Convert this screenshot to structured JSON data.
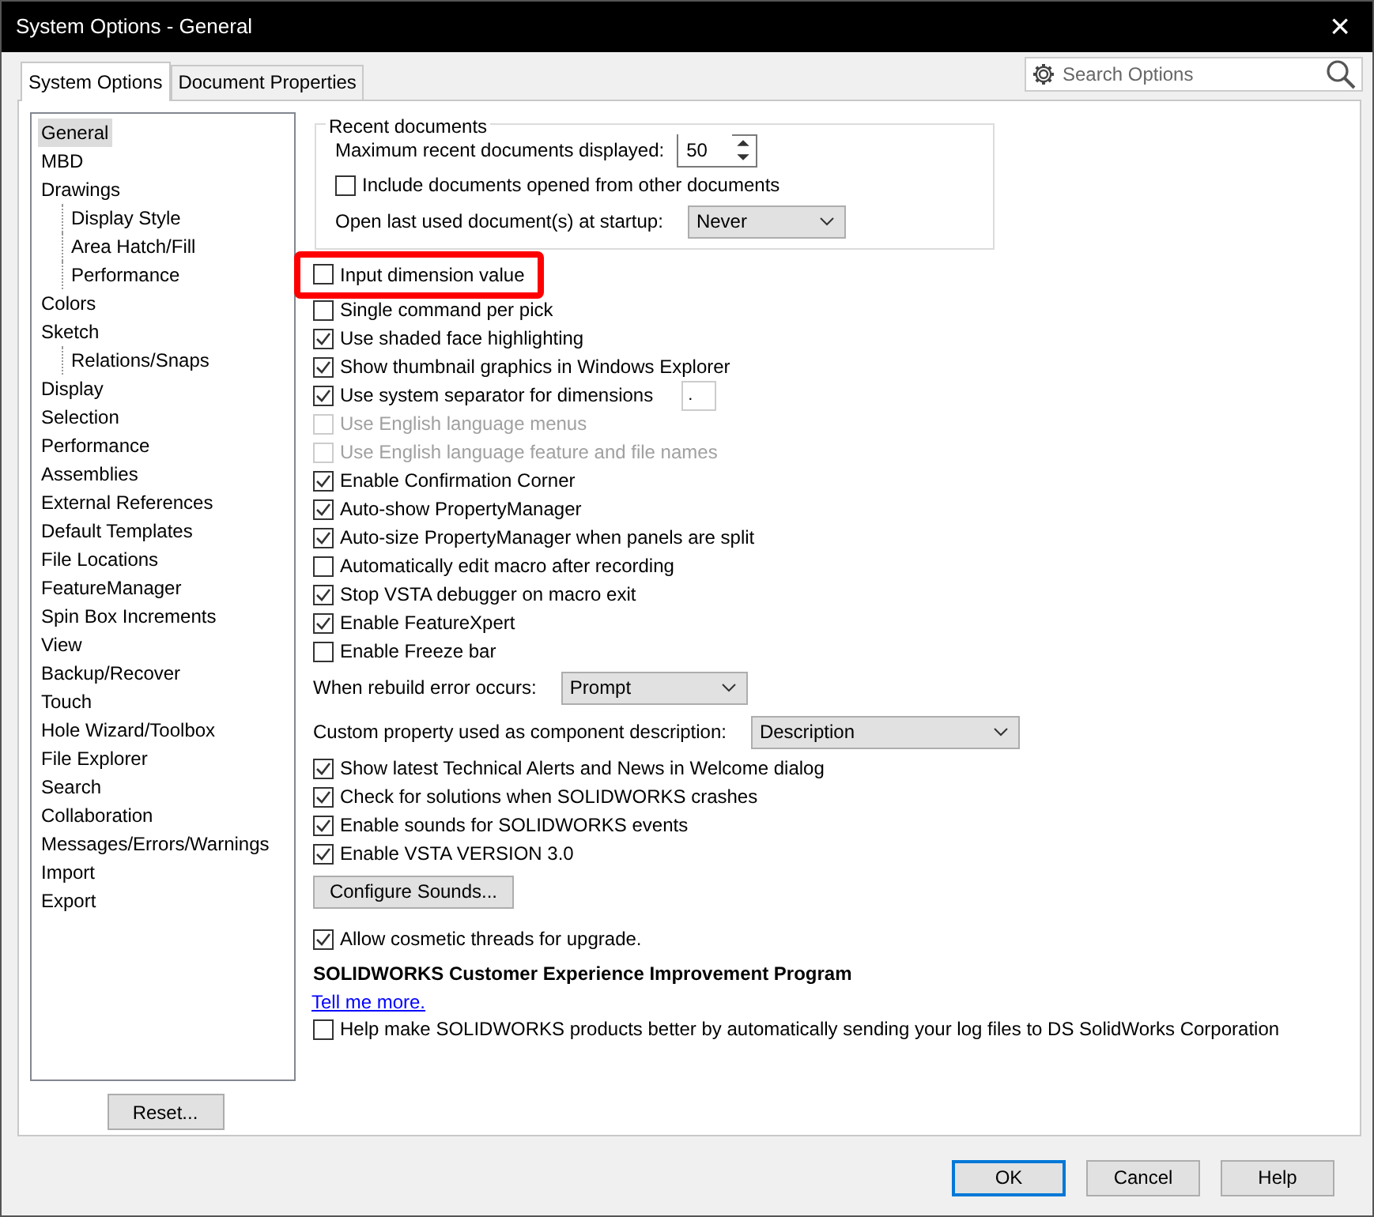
{
  "window": {
    "title": "System Options - General",
    "close": "×"
  },
  "tabs": [
    {
      "label": "System Options",
      "selected": true
    },
    {
      "label": "Document Properties",
      "selected": false
    }
  ],
  "search": {
    "placeholder": "Search Options"
  },
  "sidebar": {
    "items": [
      {
        "label": "General",
        "selected": true
      },
      {
        "label": "MBD",
        "selected": false
      },
      {
        "label": "Drawings",
        "selected": false,
        "children": [
          {
            "label": "Display Style",
            "selected": false
          },
          {
            "label": "Area Hatch/Fill",
            "selected": false
          },
          {
            "label": "Performance",
            "selected": false
          }
        ]
      },
      {
        "label": "Colors",
        "selected": false
      },
      {
        "label": "Sketch",
        "selected": false,
        "children": [
          {
            "label": "Relations/Snaps",
            "selected": false
          }
        ]
      },
      {
        "label": "Display",
        "selected": false
      },
      {
        "label": "Selection",
        "selected": false
      },
      {
        "label": "Performance",
        "selected": false
      },
      {
        "label": "Assemblies",
        "selected": false
      },
      {
        "label": "External References",
        "selected": false
      },
      {
        "label": "Default Templates",
        "selected": false
      },
      {
        "label": "File Locations",
        "selected": false
      },
      {
        "label": "FeatureManager",
        "selected": false
      },
      {
        "label": "Spin Box Increments",
        "selected": false
      },
      {
        "label": "View",
        "selected": false
      },
      {
        "label": "Backup/Recover",
        "selected": false
      },
      {
        "label": "Touch",
        "selected": false
      },
      {
        "label": "Hole Wizard/Toolbox",
        "selected": false
      },
      {
        "label": "File Explorer",
        "selected": false
      },
      {
        "label": "Search",
        "selected": false
      },
      {
        "label": "Collaboration",
        "selected": false
      },
      {
        "label": "Messages/Errors/Warnings",
        "selected": false
      },
      {
        "label": "Import",
        "selected": false
      },
      {
        "label": "Export",
        "selected": false
      }
    ],
    "reset_button": "Reset..."
  },
  "recent_documents": {
    "title": "Recent documents",
    "max_label": "Maximum recent documents displayed:",
    "max_value": "50",
    "include": {
      "label": "Include documents opened from other documents",
      "checked": false
    },
    "open_last_label": "Open last used document(s) at startup:",
    "open_last_value": "Never"
  },
  "options": [
    {
      "kind": "checkbox",
      "label": "Input dimension value",
      "checked": false,
      "disabled": false,
      "highlighted": true
    },
    {
      "kind": "checkbox",
      "label": "Single command per pick",
      "checked": false,
      "disabled": false
    },
    {
      "kind": "checkbox",
      "label": "Use shaded face highlighting",
      "checked": true,
      "disabled": false
    },
    {
      "kind": "checkbox",
      "label": "Show thumbnail graphics in Windows Explorer",
      "checked": true,
      "disabled": false
    },
    {
      "kind": "checkbox",
      "label": "Use system separator for dimensions",
      "checked": true,
      "disabled": false,
      "field_value": "."
    },
    {
      "kind": "checkbox",
      "label": "Use English language menus",
      "checked": false,
      "disabled": true
    },
    {
      "kind": "checkbox",
      "label": "Use English language feature and file names",
      "checked": false,
      "disabled": true
    },
    {
      "kind": "checkbox",
      "label": "Enable Confirmation Corner",
      "checked": true,
      "disabled": false
    },
    {
      "kind": "checkbox",
      "label": "Auto-show PropertyManager",
      "checked": true,
      "disabled": false
    },
    {
      "kind": "checkbox",
      "label": "Auto-size PropertyManager when panels are split",
      "checked": true,
      "disabled": false
    },
    {
      "kind": "checkbox",
      "label": "Automatically edit macro after recording",
      "checked": false,
      "disabled": false
    },
    {
      "kind": "checkbox",
      "label": "Stop VSTA debugger on macro exit",
      "checked": true,
      "disabled": false
    },
    {
      "kind": "checkbox",
      "label": "Enable FeatureXpert",
      "checked": true,
      "disabled": false
    },
    {
      "kind": "checkbox",
      "label": "Enable Freeze bar",
      "checked": false,
      "disabled": false
    },
    {
      "kind": "select",
      "label": "When rebuild error occurs:",
      "value": "Prompt"
    },
    {
      "kind": "select",
      "label": "Custom property used as component description:",
      "value": "Description"
    },
    {
      "kind": "checkbox",
      "label": "Show latest Technical Alerts and News in Welcome dialog",
      "checked": true,
      "disabled": false
    },
    {
      "kind": "checkbox",
      "label": "Check for solutions when SOLIDWORKS crashes",
      "checked": true,
      "disabled": false
    },
    {
      "kind": "checkbox",
      "label": "Enable sounds for SOLIDWORKS events",
      "checked": true,
      "disabled": false
    },
    {
      "kind": "checkbox",
      "label": "Enable VSTA VERSION 3.0",
      "checked": true,
      "disabled": false
    },
    {
      "kind": "button",
      "label": "Configure Sounds..."
    },
    {
      "kind": "checkbox",
      "label": "Allow cosmetic threads for upgrade.",
      "checked": true,
      "disabled": false
    },
    {
      "kind": "heading",
      "label": "SOLIDWORKS Customer Experience Improvement Program"
    },
    {
      "kind": "link",
      "label": "Tell me more."
    },
    {
      "kind": "checkbox",
      "label": "Help make SOLIDWORKS products better by automatically sending your log files to DS SolidWorks Corporation",
      "checked": false,
      "disabled": false
    }
  ],
  "buttons": [
    {
      "label": "OK",
      "default": true
    },
    {
      "label": "Cancel",
      "default": false
    },
    {
      "label": "Help",
      "default": false
    }
  ]
}
